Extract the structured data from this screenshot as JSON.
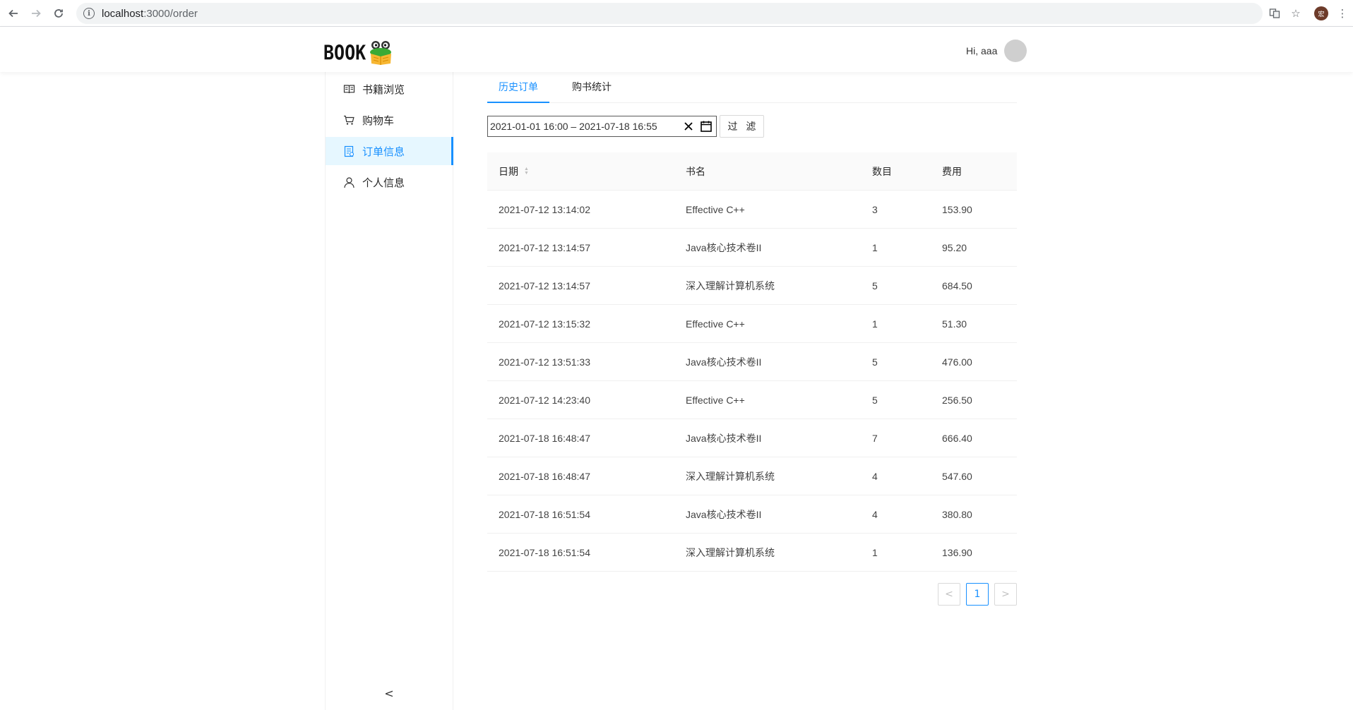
{
  "browser": {
    "url_host": "localhost",
    "url_path": ":3000/order"
  },
  "header": {
    "logo_text": "BOOK",
    "greeting": "Hi, aaa"
  },
  "sidebar": {
    "items": [
      {
        "label": "书籍浏览",
        "icon": "book-icon"
      },
      {
        "label": "购物车",
        "icon": "cart-icon"
      },
      {
        "label": "订单信息",
        "icon": "order-icon"
      },
      {
        "label": "个人信息",
        "icon": "user-icon"
      }
    ],
    "collapse_symbol": "<"
  },
  "tabs": [
    {
      "label": "历史订单"
    },
    {
      "label": "购书统计"
    }
  ],
  "filter": {
    "range_text": "2021-01-01 16:00 – 2021-07-18 16:55",
    "button_label": "过 滤"
  },
  "table": {
    "columns": [
      "日期",
      "书名",
      "数目",
      "费用"
    ],
    "rows": [
      {
        "date": "2021-07-12 13:14:02",
        "book": "Effective C++",
        "count": "3",
        "cost": "153.90"
      },
      {
        "date": "2021-07-12 13:14:57",
        "book": "Java核心技术卷II",
        "count": "1",
        "cost": "95.20"
      },
      {
        "date": "2021-07-12 13:14:57",
        "book": "深入理解计算机系统",
        "count": "5",
        "cost": "684.50"
      },
      {
        "date": "2021-07-12 13:15:32",
        "book": "Effective C++",
        "count": "1",
        "cost": "51.30"
      },
      {
        "date": "2021-07-12 13:51:33",
        "book": "Java核心技术卷II",
        "count": "5",
        "cost": "476.00"
      },
      {
        "date": "2021-07-12 14:23:40",
        "book": "Effective C++",
        "count": "5",
        "cost": "256.50"
      },
      {
        "date": "2021-07-18 16:48:47",
        "book": "Java核心技术卷II",
        "count": "7",
        "cost": "666.40"
      },
      {
        "date": "2021-07-18 16:48:47",
        "book": "深入理解计算机系统",
        "count": "4",
        "cost": "547.60"
      },
      {
        "date": "2021-07-18 16:51:54",
        "book": "Java核心技术卷II",
        "count": "4",
        "cost": "380.80"
      },
      {
        "date": "2021-07-18 16:51:54",
        "book": "深入理解计算机系统",
        "count": "1",
        "cost": "136.90"
      }
    ]
  },
  "pagination": {
    "prev": "<",
    "current": "1",
    "next": ">"
  },
  "colors": {
    "accent": "#1890ff",
    "selected_bg": "#e6f7ff"
  }
}
